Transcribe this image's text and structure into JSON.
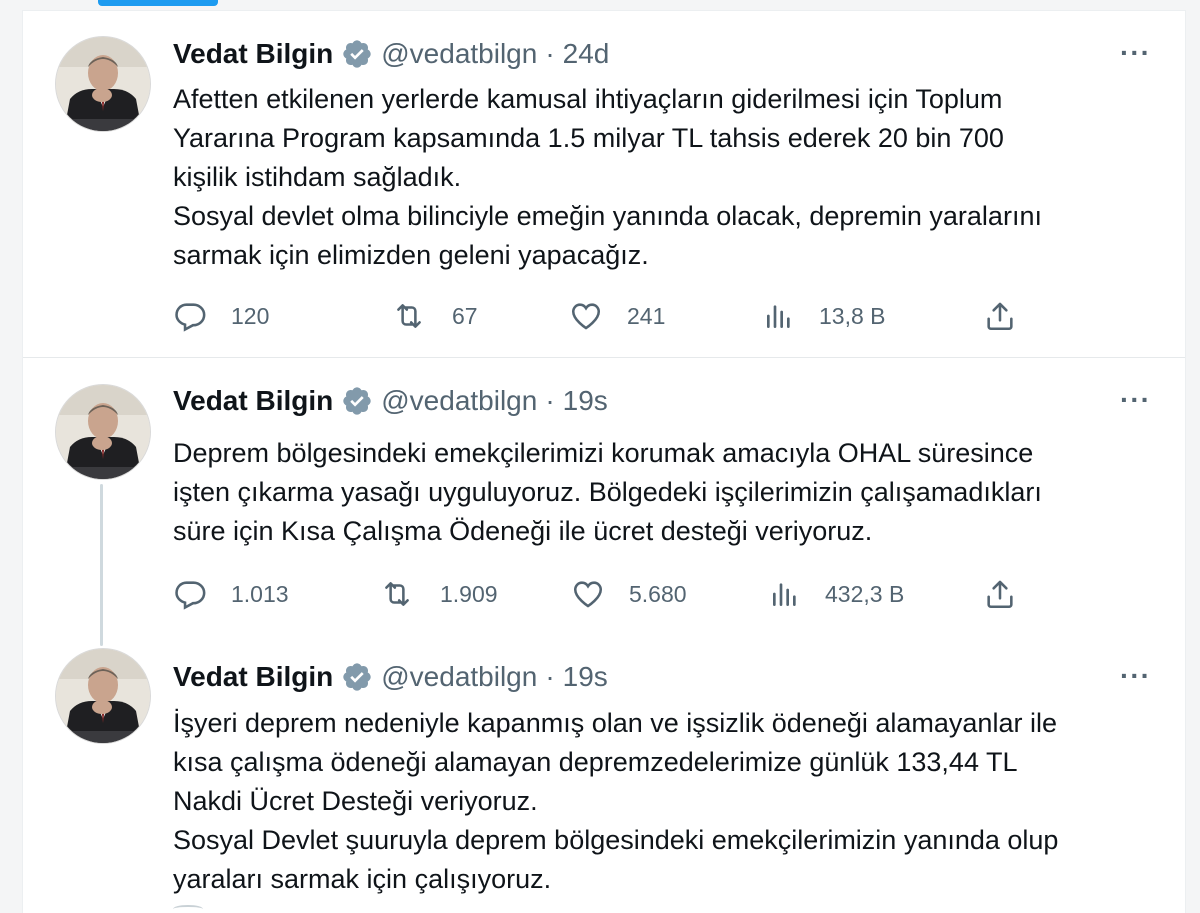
{
  "tweets": [
    {
      "name": "Vedat Bilgin",
      "handle": "@vedatbilgn",
      "time": "24d",
      "lines": [
        "Afetten etkilenen yerlerde kamusal ihtiyaçların giderilmesi için Toplum",
        "Yararına Program kapsamında 1.5 milyar TL tahsis ederek 20 bin 700",
        "kişilik istihdam sağladık.",
        "Sosyal devlet olma bilinciyle emeğin yanında olacak, depremin yaralarını",
        "sarmak için elimizden geleni yapacağız."
      ],
      "replies": "120",
      "retweets": "67",
      "likes": "241",
      "views": "13,8 B"
    },
    {
      "name": "Vedat Bilgin",
      "handle": "@vedatbilgn",
      "time": "19s",
      "lines": [
        "Deprem bölgesindeki emekçilerimizi korumak amacıyla OHAL süresince",
        "işten çıkarma yasağı uyguluyoruz. Bölgedeki işçilerimizin çalışamadıkları",
        "süre için Kısa Çalışma Ödeneği ile ücret desteği veriyoruz."
      ],
      "replies": "1.013",
      "retweets": "1.909",
      "likes": "5.680",
      "views": "432,3 B"
    },
    {
      "name": "Vedat Bilgin",
      "handle": "@vedatbilgn",
      "time": "19s",
      "lines": [
        "İşyeri deprem nedeniyle kapanmış olan ve işsizlik ödeneği alamayanlar ile",
        "kısa çalışma ödeneği alamayan depremzedelerimize günlük 133,44 TL",
        "Nakdi Ücret Desteği veriyoruz.",
        "Sosyal Devlet şuuruyla deprem bölgesindeki emekçilerimizin yanında olup",
        "yaraları sarmak için çalışıyoruz."
      ]
    }
  ],
  "ui": {
    "separator": "·",
    "more": "···",
    "accent_color": "#1d9bf0",
    "verified_color": "#829aab",
    "icons": [
      "reply-icon",
      "retweet-icon",
      "like-icon",
      "views-icon",
      "share-icon",
      "verified-badge-icon",
      "more-icon"
    ]
  }
}
